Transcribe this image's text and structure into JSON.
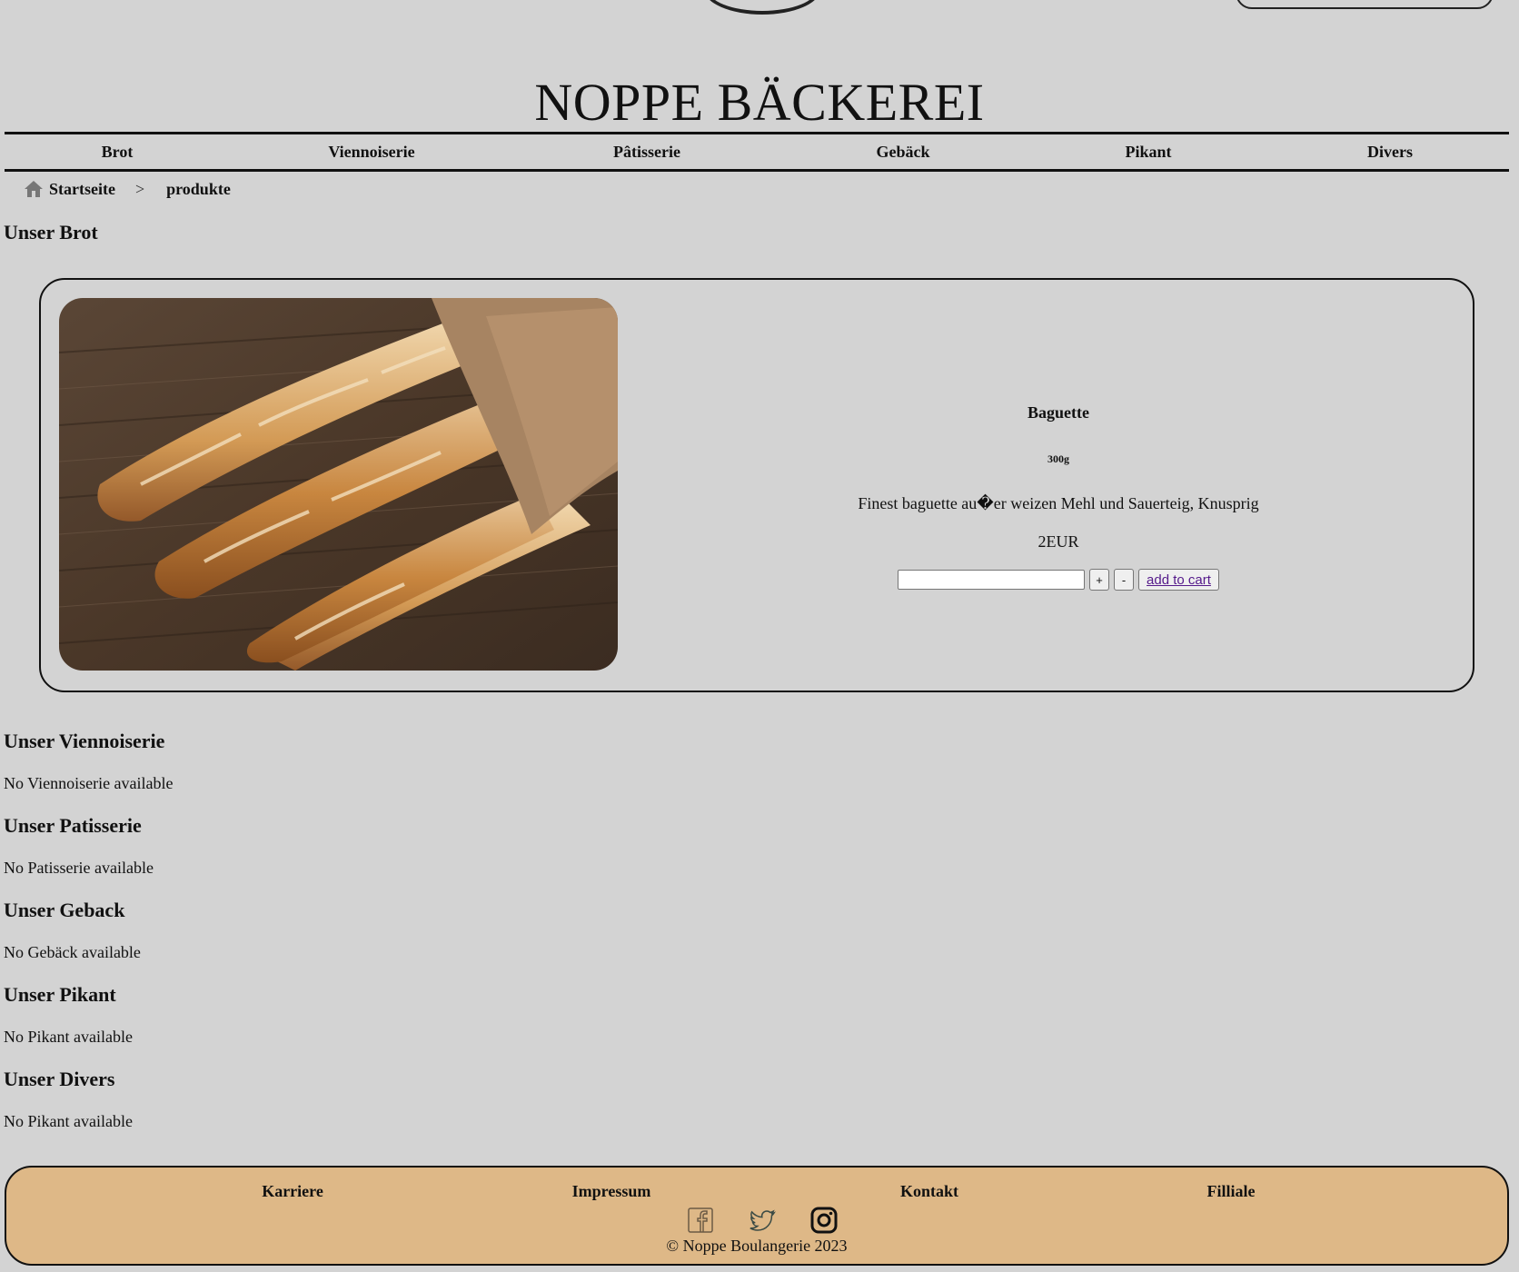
{
  "site": {
    "title": "NOPPE BÄCKEREI"
  },
  "nav": {
    "items": [
      "Brot",
      "Viennoiserie",
      "Pâtisserie",
      "Gebäck",
      "Pikant",
      "Divers"
    ]
  },
  "breadcrumb": {
    "home": "Startseite",
    "separator": ">",
    "current": "produkte"
  },
  "sections": {
    "brot": {
      "heading": "Unser Brot"
    },
    "viennoiserie": {
      "heading": "Unser Viennoiserie",
      "empty": "No Viennoiserie available"
    },
    "patisserie": {
      "heading": "Unser Patisserie",
      "empty": "No Patisserie available"
    },
    "geback": {
      "heading": "Unser Geback",
      "empty": "No Gebäck available"
    },
    "pikant": {
      "heading": "Unser Pikant",
      "empty": "No Pikant available"
    },
    "divers": {
      "heading": "Unser Divers",
      "empty": "No Pikant available"
    }
  },
  "product": {
    "name": "Baguette",
    "weight": "300g",
    "description": "Finest baguette au�er weizen Mehl und Sauerteig, Knusprig",
    "price": "2EUR",
    "quantity_value": "",
    "plus_label": "+",
    "minus_label": "-",
    "cart_label": "add to cart",
    "image_icon": "baguette-photo"
  },
  "footer": {
    "links": [
      "Karriere",
      "Impressum",
      "Kontakt",
      "Filliale"
    ],
    "social_icons": [
      "facebook-icon",
      "twitter-icon",
      "instagram-icon"
    ],
    "copyright": "© Noppe Boulangerie 2023"
  },
  "colors": {
    "background": "#d3d3d3",
    "footer": "#deb887",
    "border": "#111111",
    "link_visited": "#551a8b"
  }
}
